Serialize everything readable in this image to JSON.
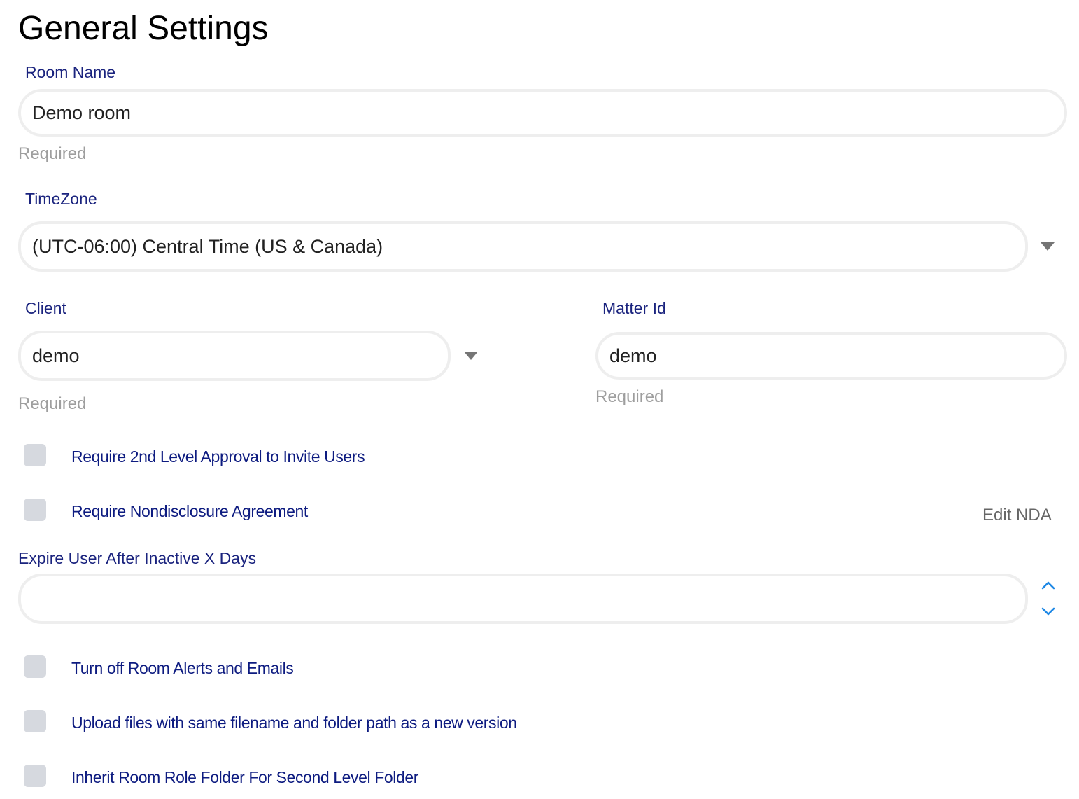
{
  "page": {
    "title": "General Settings"
  },
  "room_name": {
    "label": "Room Name",
    "value": "Demo room",
    "helper": "Required"
  },
  "timezone": {
    "label": "TimeZone",
    "value": "(UTC-06:00) Central Time (US & Canada)",
    "icon": "chevron-down-icon"
  },
  "client": {
    "label": "Client",
    "value": "demo",
    "helper": "Required",
    "icon": "chevron-down-icon"
  },
  "matter_id": {
    "label": "Matter Id",
    "value": "demo",
    "helper": "Required"
  },
  "options_top": [
    {
      "label": "Require 2nd Level Approval to Invite Users",
      "checked": false
    },
    {
      "label": "Require Nondisclosure Agreement",
      "checked": false
    }
  ],
  "edit_nda": {
    "label": "Edit NDA"
  },
  "expire_user": {
    "label": "Expire User After Inactive X Days",
    "value": "",
    "icons": [
      "chevron-up-icon",
      "chevron-down-icon"
    ]
  },
  "options_bottom": [
    {
      "label": "Turn off Room Alerts and Emails",
      "checked": false
    },
    {
      "label": "Upload files with same filename and folder path as a new version",
      "checked": false
    },
    {
      "label": "Inherit Room Role Folder For Second Level Folder",
      "checked": false
    }
  ],
  "colors": {
    "label": "#1a237e",
    "checkbox_label": "#0d1b80",
    "helper": "#9e9e9e",
    "checkbox_bg": "#d6d9df",
    "field_border": "#eeeeee",
    "spinner_accent": "#1e88e5"
  }
}
